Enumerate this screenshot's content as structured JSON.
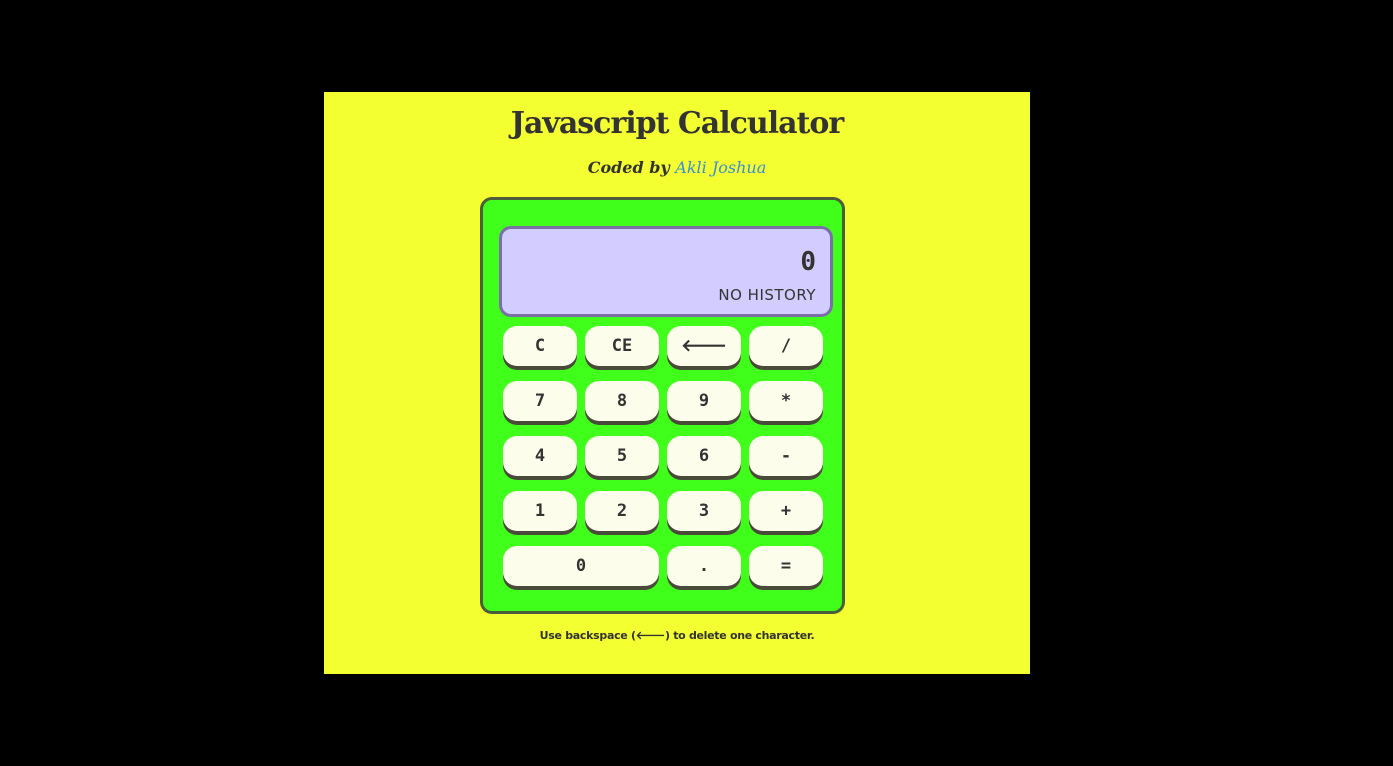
{
  "header": {
    "title": "Javascript Calculator",
    "coded_by": "Coded by",
    "author": "Akli Joshua"
  },
  "display": {
    "current_value": "0",
    "history": "NO HISTORY"
  },
  "keys": {
    "clear": "C",
    "clear_entry": "CE",
    "backspace": "🡐",
    "divide": "/",
    "seven": "7",
    "eight": "8",
    "nine": "9",
    "multiply": "*",
    "four": "4",
    "five": "5",
    "six": "6",
    "subtract": "-",
    "one": "1",
    "two": "2",
    "three": "3",
    "add": "+",
    "zero": "0",
    "decimal": ".",
    "equals": "="
  },
  "footer": {
    "text_before": "Use backspace (",
    "backspace_icon": "🡐",
    "text_after": ") to delete one character."
  },
  "colors": {
    "background": "#000000",
    "panel": "#f4ff31",
    "calculator_body": "#40ff1a",
    "screen": "#d2ccff",
    "keys": "#fdfdeb",
    "author_link": "#3a8fd4",
    "text": "#333333"
  }
}
